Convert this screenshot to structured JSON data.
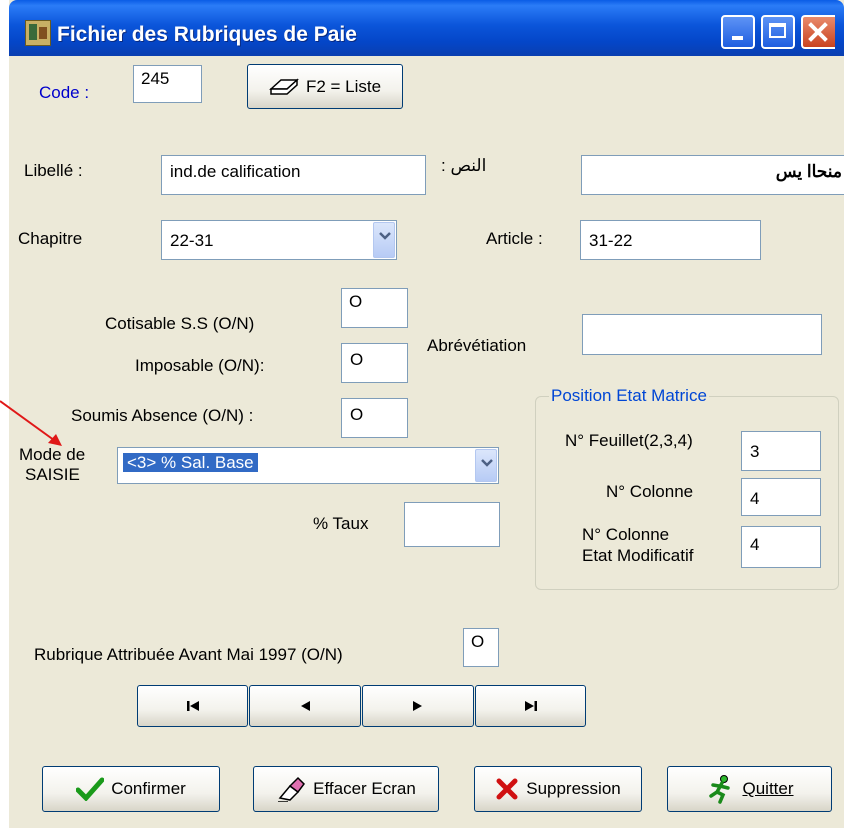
{
  "window": {
    "title": "Fichier des Rubriques de Paie"
  },
  "code": {
    "label": "Code :",
    "value": "245"
  },
  "list_button": {
    "label": "F2 = Liste"
  },
  "libelle": {
    "label": "Libellé :",
    "value": "ind.de calification"
  },
  "nass": {
    "label": ": النص",
    "value": "منحاا يس"
  },
  "chapitre": {
    "label": "Chapitre",
    "value": "22-31"
  },
  "article": {
    "label": "Article :",
    "value": "31-22"
  },
  "cotisable": {
    "label": "Cotisable S.S (O/N)",
    "value": "O"
  },
  "imposable": {
    "label": "Imposable (O/N):",
    "value": "O"
  },
  "soumis": {
    "label": "Soumis Absence (O/N) :",
    "value": "O"
  },
  "abreviation": {
    "label": "Abrévétiation",
    "value": ""
  },
  "mode_saisie": {
    "label_line1": "Mode de",
    "label_line2": "SAISIE",
    "value": "<3>  % Sal. Base"
  },
  "taux": {
    "label": "%  Taux",
    "value": ""
  },
  "position": {
    "title": "Position Etat Matrice",
    "feuillet_label": "N° Feuillet(2,3,4)",
    "feuillet_value": "3",
    "colonne_label": "N° Colonne",
    "colonne_value": "4",
    "colonne_modif_label1": "N° Colonne",
    "colonne_modif_label2": "Etat Modificatif",
    "colonne_modif_value": "4"
  },
  "rubrique_avant": {
    "label": "Rubrique Attribuée Avant  Mai 1997 (O/N)",
    "value": "O"
  },
  "nav": {
    "first": "first-record",
    "prev": "previous-record",
    "next": "next-record",
    "last": "last-record"
  },
  "actions": {
    "confirmer": "Confirmer",
    "effacer": "Effacer Ecran",
    "suppression": "Suppression",
    "quitter": "Quitter"
  },
  "colors": {
    "title_blue": "#0a55da",
    "label_blue": "#0000cc",
    "group_title": "#0046d5",
    "annotation_arrow": "#e01818"
  }
}
